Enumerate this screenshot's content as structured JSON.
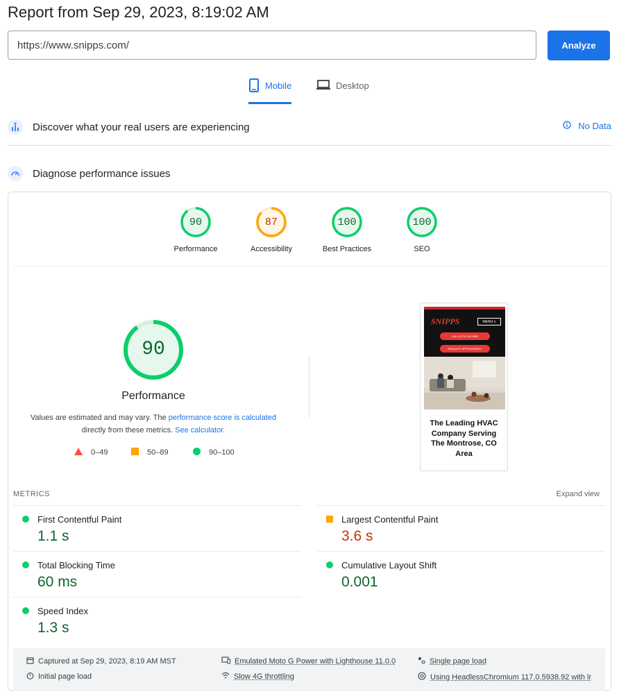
{
  "header": {
    "title": "Report from Sep 29, 2023, 8:19:02 AM"
  },
  "search": {
    "url_value": "https://www.snipps.com/",
    "analyze_label": "Analyze"
  },
  "tabs": [
    {
      "label": "Mobile",
      "icon": "phone-icon",
      "active": true
    },
    {
      "label": "Desktop",
      "icon": "laptop-icon",
      "active": false
    }
  ],
  "crux": {
    "title": "Discover what your real users are experiencing",
    "status": "No Data",
    "icon": "users-chart-icon"
  },
  "diagnose": {
    "title": "Diagnose performance issues",
    "icon": "gauge-icon"
  },
  "scores": [
    {
      "label": "Performance",
      "value": 90,
      "color": "#0cce6b"
    },
    {
      "label": "Accessibility",
      "value": 87,
      "color": "#ffa400"
    },
    {
      "label": "Best Practices",
      "value": 100,
      "color": "#0cce6b"
    },
    {
      "label": "SEO",
      "value": 100,
      "color": "#0cce6b"
    }
  ],
  "perf": {
    "score": 90,
    "label": "Performance",
    "desc_1": "Values are estimated and may vary. The ",
    "desc_link_1": "performance score is calculated",
    "desc_2": "directly from these metrics. ",
    "desc_link_2": "See calculator.",
    "legend": [
      {
        "range": "0–49",
        "shape": "triangle",
        "color": "#ff4e42"
      },
      {
        "range": "50–89",
        "shape": "square",
        "color": "#ffa400"
      },
      {
        "range": "90–100",
        "shape": "circle",
        "color": "#0cce6b"
      }
    ]
  },
  "screenshot": {
    "logo": "SNIPPS",
    "menu": "MENU ≡",
    "call_btn": "CALL (970) 240-9962",
    "request_btn": "REQUEST APPOINTMENT",
    "headline": "The Leading HVAC Company Serving The Montrose, CO Area"
  },
  "metrics": {
    "heading": "METRICS",
    "expand": "Expand view",
    "items": [
      {
        "label": "First Contentful Paint",
        "value": "1.1 s",
        "status": "good"
      },
      {
        "label": "Largest Contentful Paint",
        "value": "3.6 s",
        "status": "average"
      },
      {
        "label": "Total Blocking Time",
        "value": "60 ms",
        "status": "good"
      },
      {
        "label": "Cumulative Layout Shift",
        "value": "0.001",
        "status": "good"
      },
      {
        "label": "Speed Index",
        "value": "1.3 s",
        "status": "good"
      }
    ]
  },
  "footer": {
    "captured": "Captured at Sep 29, 2023, 8:19 AM MST",
    "initial": "Initial page load",
    "emulated": "Emulated Moto G Power with Lighthouse 11.0.0",
    "throttling": "Slow 4G throttling",
    "single": "Single page load",
    "browser": "Using HeadlessChromium 117.0.5938.92 with lr"
  },
  "colors": {
    "accent": "#1a73e8",
    "good": "#0cce6b",
    "average": "#ffa400",
    "poor": "#ff4e42",
    "good_text": "#0d652d",
    "average_text": "#c33300"
  }
}
